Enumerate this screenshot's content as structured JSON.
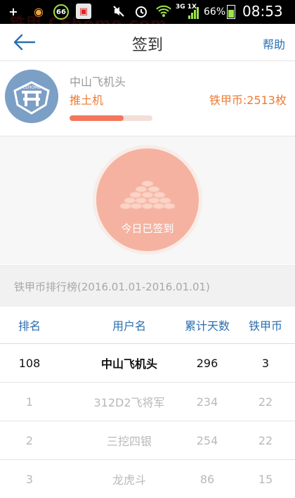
{
  "status_bar": {
    "notification_badge": "66",
    "network": "3G 1X",
    "battery_percent": "66%",
    "time": "08:53"
  },
  "watermark": "铁甲 CEhome.com",
  "header": {
    "title": "签到",
    "help_label": "帮助"
  },
  "profile": {
    "username": "中山飞机头",
    "rank_title": "推土机",
    "coins_text": "铁甲币:2513枚",
    "level_progress": 0.65
  },
  "signin": {
    "label": "今日已签到"
  },
  "ranking": {
    "title": "铁甲币排行榜(2016.01.01-2016.01.01)",
    "columns": [
      "排名",
      "用户名",
      "累计天数",
      "铁甲币"
    ],
    "my_row": {
      "rank": "108",
      "user": "中山飞机头",
      "days": "296",
      "coins": "3"
    },
    "rows": [
      {
        "rank": "1",
        "user": "312D2飞将军",
        "days": "234",
        "coins": "22"
      },
      {
        "rank": "2",
        "user": "三挖四银",
        "days": "254",
        "coins": "22"
      },
      {
        "rank": "3",
        "user": "龙虎斗",
        "days": "86",
        "coins": "15"
      }
    ]
  },
  "colors": {
    "accent_blue": "#2a6fb0",
    "accent_orange": "#ee7a33",
    "signin_circle": "#f5b2a0"
  }
}
